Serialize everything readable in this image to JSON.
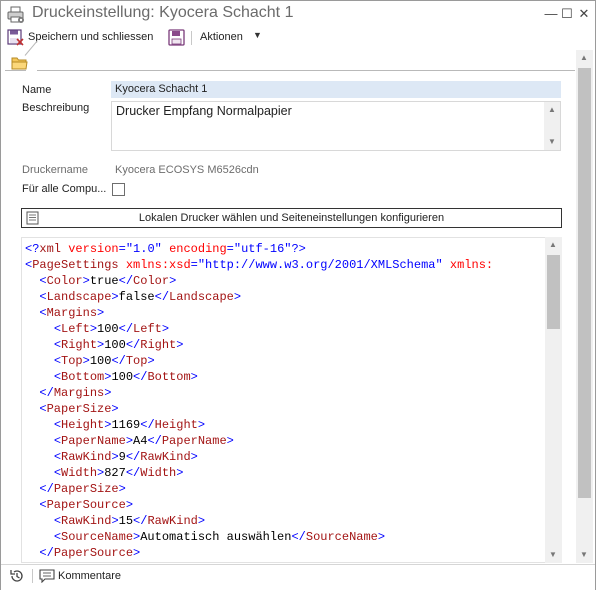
{
  "window": {
    "title": "Druckeinstellung: Kyocera Schacht 1",
    "minimize_glyph": "—",
    "maximize_glyph": "☐",
    "close_glyph": "✕"
  },
  "toolbar": {
    "save_close_label": "Speichern und schliessen",
    "actions_label": "Aktionen",
    "actions_caret": "▼"
  },
  "form": {
    "name_label": "Name",
    "name_value": "Kyocera Schacht 1",
    "description_label": "Beschreibung",
    "description_value": "Drucker Empfang Normalpapier",
    "printer_name_label": "Druckername",
    "printer_name_value": "Kyocera ECOSYS M6526cdn",
    "all_computers_label": "Für alle Compu...",
    "all_computers_checked": false,
    "select_printer_button": "Lokalen Drucker wählen und Seiteneinstellungen konfigurieren"
  },
  "xml_editor": {
    "lines": [
      {
        "indent": 0,
        "parts": [
          [
            "br",
            "<?"
          ],
          [
            "tag",
            "xml"
          ],
          [
            "text",
            " "
          ],
          [
            "attr",
            "version"
          ],
          [
            "br",
            "="
          ],
          [
            "val",
            "\"1.0\""
          ],
          [
            "text",
            " "
          ],
          [
            "attr",
            "encoding"
          ],
          [
            "br",
            "="
          ],
          [
            "val",
            "\"utf-16\""
          ],
          [
            "br",
            "?>"
          ]
        ]
      },
      {
        "indent": 0,
        "parts": [
          [
            "br",
            "<"
          ],
          [
            "tag",
            "PageSettings"
          ],
          [
            "text",
            " "
          ],
          [
            "attr",
            "xmlns:xsd"
          ],
          [
            "br",
            "="
          ],
          [
            "val",
            "\"http://www.w3.org/2001/XMLSchema\""
          ],
          [
            "text",
            " "
          ],
          [
            "attr",
            "xmlns:"
          ]
        ]
      },
      {
        "indent": 1,
        "parts": [
          [
            "br",
            "<"
          ],
          [
            "tag",
            "Color"
          ],
          [
            "br",
            ">"
          ],
          [
            "text",
            "true"
          ],
          [
            "br",
            "</"
          ],
          [
            "tag",
            "Color"
          ],
          [
            "br",
            ">"
          ]
        ]
      },
      {
        "indent": 1,
        "parts": [
          [
            "br",
            "<"
          ],
          [
            "tag",
            "Landscape"
          ],
          [
            "br",
            ">"
          ],
          [
            "text",
            "false"
          ],
          [
            "br",
            "</"
          ],
          [
            "tag",
            "Landscape"
          ],
          [
            "br",
            ">"
          ]
        ]
      },
      {
        "indent": 1,
        "parts": [
          [
            "br",
            "<"
          ],
          [
            "tag",
            "Margins"
          ],
          [
            "br",
            ">"
          ]
        ]
      },
      {
        "indent": 2,
        "parts": [
          [
            "br",
            "<"
          ],
          [
            "tag",
            "Left"
          ],
          [
            "br",
            ">"
          ],
          [
            "text",
            "100"
          ],
          [
            "br",
            "</"
          ],
          [
            "tag",
            "Left"
          ],
          [
            "br",
            ">"
          ]
        ]
      },
      {
        "indent": 2,
        "parts": [
          [
            "br",
            "<"
          ],
          [
            "tag",
            "Right"
          ],
          [
            "br",
            ">"
          ],
          [
            "text",
            "100"
          ],
          [
            "br",
            "</"
          ],
          [
            "tag",
            "Right"
          ],
          [
            "br",
            ">"
          ]
        ]
      },
      {
        "indent": 2,
        "parts": [
          [
            "br",
            "<"
          ],
          [
            "tag",
            "Top"
          ],
          [
            "br",
            ">"
          ],
          [
            "text",
            "100"
          ],
          [
            "br",
            "</"
          ],
          [
            "tag",
            "Top"
          ],
          [
            "br",
            ">"
          ]
        ]
      },
      {
        "indent": 2,
        "parts": [
          [
            "br",
            "<"
          ],
          [
            "tag",
            "Bottom"
          ],
          [
            "br",
            ">"
          ],
          [
            "text",
            "100"
          ],
          [
            "br",
            "</"
          ],
          [
            "tag",
            "Bottom"
          ],
          [
            "br",
            ">"
          ]
        ]
      },
      {
        "indent": 1,
        "parts": [
          [
            "br",
            "</"
          ],
          [
            "tag",
            "Margins"
          ],
          [
            "br",
            ">"
          ]
        ]
      },
      {
        "indent": 1,
        "parts": [
          [
            "br",
            "<"
          ],
          [
            "tag",
            "PaperSize"
          ],
          [
            "br",
            ">"
          ]
        ]
      },
      {
        "indent": 2,
        "parts": [
          [
            "br",
            "<"
          ],
          [
            "tag",
            "Height"
          ],
          [
            "br",
            ">"
          ],
          [
            "text",
            "1169"
          ],
          [
            "br",
            "</"
          ],
          [
            "tag",
            "Height"
          ],
          [
            "br",
            ">"
          ]
        ]
      },
      {
        "indent": 2,
        "parts": [
          [
            "br",
            "<"
          ],
          [
            "tag",
            "PaperName"
          ],
          [
            "br",
            ">"
          ],
          [
            "text",
            "A4"
          ],
          [
            "br",
            "</"
          ],
          [
            "tag",
            "PaperName"
          ],
          [
            "br",
            ">"
          ]
        ]
      },
      {
        "indent": 2,
        "parts": [
          [
            "br",
            "<"
          ],
          [
            "tag",
            "RawKind"
          ],
          [
            "br",
            ">"
          ],
          [
            "text",
            "9"
          ],
          [
            "br",
            "</"
          ],
          [
            "tag",
            "RawKind"
          ],
          [
            "br",
            ">"
          ]
        ]
      },
      {
        "indent": 2,
        "parts": [
          [
            "br",
            "<"
          ],
          [
            "tag",
            "Width"
          ],
          [
            "br",
            ">"
          ],
          [
            "text",
            "827"
          ],
          [
            "br",
            "</"
          ],
          [
            "tag",
            "Width"
          ],
          [
            "br",
            ">"
          ]
        ]
      },
      {
        "indent": 1,
        "parts": [
          [
            "br",
            "</"
          ],
          [
            "tag",
            "PaperSize"
          ],
          [
            "br",
            ">"
          ]
        ]
      },
      {
        "indent": 1,
        "parts": [
          [
            "br",
            "<"
          ],
          [
            "tag",
            "PaperSource"
          ],
          [
            "br",
            ">"
          ]
        ]
      },
      {
        "indent": 2,
        "parts": [
          [
            "br",
            "<"
          ],
          [
            "tag",
            "RawKind"
          ],
          [
            "br",
            ">"
          ],
          [
            "text",
            "15"
          ],
          [
            "br",
            "</"
          ],
          [
            "tag",
            "RawKind"
          ],
          [
            "br",
            ">"
          ]
        ]
      },
      {
        "indent": 2,
        "parts": [
          [
            "br",
            "<"
          ],
          [
            "tag",
            "SourceName"
          ],
          [
            "br",
            ">"
          ],
          [
            "text",
            "Automatisch auswählen"
          ],
          [
            "br",
            "</"
          ],
          [
            "tag",
            "SourceName"
          ],
          [
            "br",
            ">"
          ]
        ]
      },
      {
        "indent": 1,
        "parts": [
          [
            "br",
            "</"
          ],
          [
            "tag",
            "PaperSource"
          ],
          [
            "br",
            ">"
          ]
        ]
      }
    ]
  },
  "statusbar": {
    "comments_label": "Kommentare"
  },
  "icons": {
    "title": "printer-settings-icon",
    "save_close": "save-close-icon",
    "save": "floppy-disk-icon",
    "tab": "folder-icon",
    "select_printer": "document-icon",
    "history": "history-icon",
    "comments": "comment-icon"
  },
  "colors": {
    "name_field_bg": "#dde8f5",
    "xml_tag": "#a31515",
    "xml_bracket": "#0000ff",
    "xml_attr": "#ff0000",
    "xml_value": "#0000ff"
  }
}
